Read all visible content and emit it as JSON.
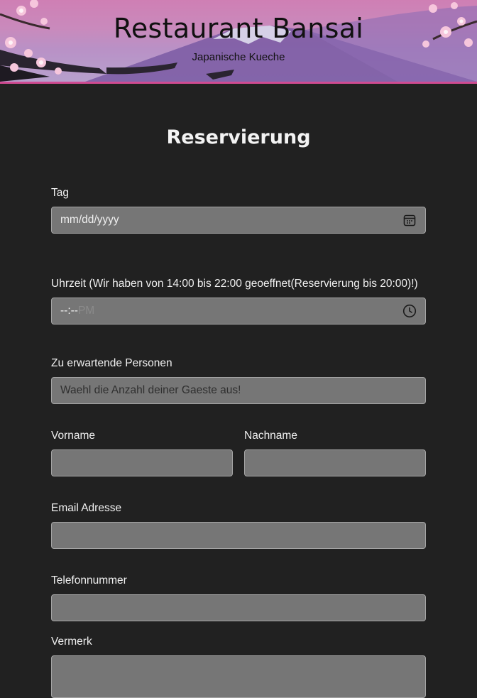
{
  "header": {
    "title": "Restaurant Bansai",
    "subtitle": "Japanische Kueche"
  },
  "form": {
    "title": "Reservierung",
    "date": {
      "label": "Tag",
      "value": "mm/dd/yyyy",
      "icon": "calendar-icon"
    },
    "time": {
      "label": "Uhrzeit (Wir haben von 14:00 bis 22:00 geoeffnet(Reservierung bis 20:00)!)",
      "value": "--:--",
      "ampm": "PM",
      "icon": "clock-icon"
    },
    "persons": {
      "label": "Zu erwartende Personen",
      "placeholder": "Waehl die Anzahl deiner Gaeste aus!"
    },
    "firstname": {
      "label": "Vorname"
    },
    "lastname": {
      "label": "Nachname"
    },
    "email": {
      "label": "Email Adresse"
    },
    "phone": {
      "label": "Telefonnummer"
    },
    "note": {
      "label": "Vermerk"
    }
  },
  "colors": {
    "background": "#212121",
    "field_bg": "#767676",
    "header_border": "#d04b92"
  }
}
